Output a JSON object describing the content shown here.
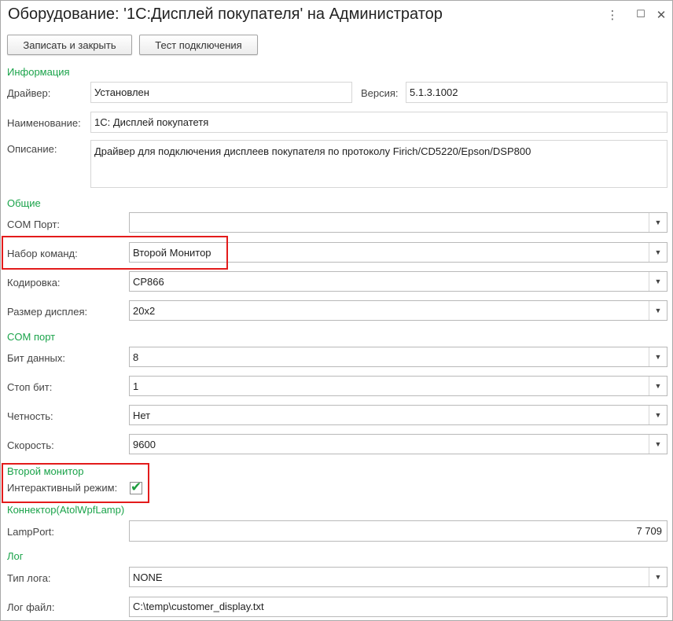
{
  "window": {
    "title": "Оборудование: '1С:Дисплей покупателя' на Администратор",
    "more_icon": "⋮",
    "maximize_icon": "☐",
    "close_icon": "✕"
  },
  "toolbar": {
    "save_close_label": "Записать и закрыть",
    "test_connection_label": "Тест подключения"
  },
  "info": {
    "section_title": "Информация",
    "driver_label": "Драйвер:",
    "driver_value": "Установлен",
    "version_label": "Версия:",
    "version_value": "5.1.3.1002",
    "name_label": "Наименование:",
    "name_value": "1С: Дисплей покупатетя",
    "description_label": "Описание:",
    "description_value": "Драйвер для подключения дисплеев покупателя по протоколу Firich/CD5220/Epson/DSP800"
  },
  "general": {
    "section_title": "Общие",
    "com_port_label": "COM Порт:",
    "com_port_value": "",
    "command_set_label": "Набор команд:",
    "command_set_value": "Второй Монитор",
    "encoding_label": "Кодировка:",
    "encoding_value": "CP866",
    "display_size_label": "Размер дисплея:",
    "display_size_value": "20x2"
  },
  "com": {
    "section_title": "COM порт",
    "data_bits_label": "Бит данных:",
    "data_bits_value": "8",
    "stop_bits_label": "Стоп бит:",
    "stop_bits_value": "1",
    "parity_label": "Четность:",
    "parity_value": "Нет",
    "speed_label": "Скорость:",
    "speed_value": "9600"
  },
  "second_monitor": {
    "section_title": "Второй монитор",
    "interactive_label": "Интерактивный режим:",
    "interactive_checked": true,
    "check_mark": "✔"
  },
  "connector": {
    "section_title": "Коннектор(AtolWpfLamp)",
    "lamp_port_label": "LampPort:",
    "lamp_port_value": "7 709"
  },
  "log": {
    "section_title": "Лог",
    "log_type_label": "Тип лога:",
    "log_type_value": "NONE",
    "log_file_label": "Лог файл:",
    "log_file_value": "C:\\temp\\customer_display.txt"
  },
  "icons": {
    "dropdown_arrow": "▼"
  },
  "colors": {
    "section": "#1aa34a",
    "highlight": "#e31b1b",
    "check": "#1e9c3e"
  }
}
